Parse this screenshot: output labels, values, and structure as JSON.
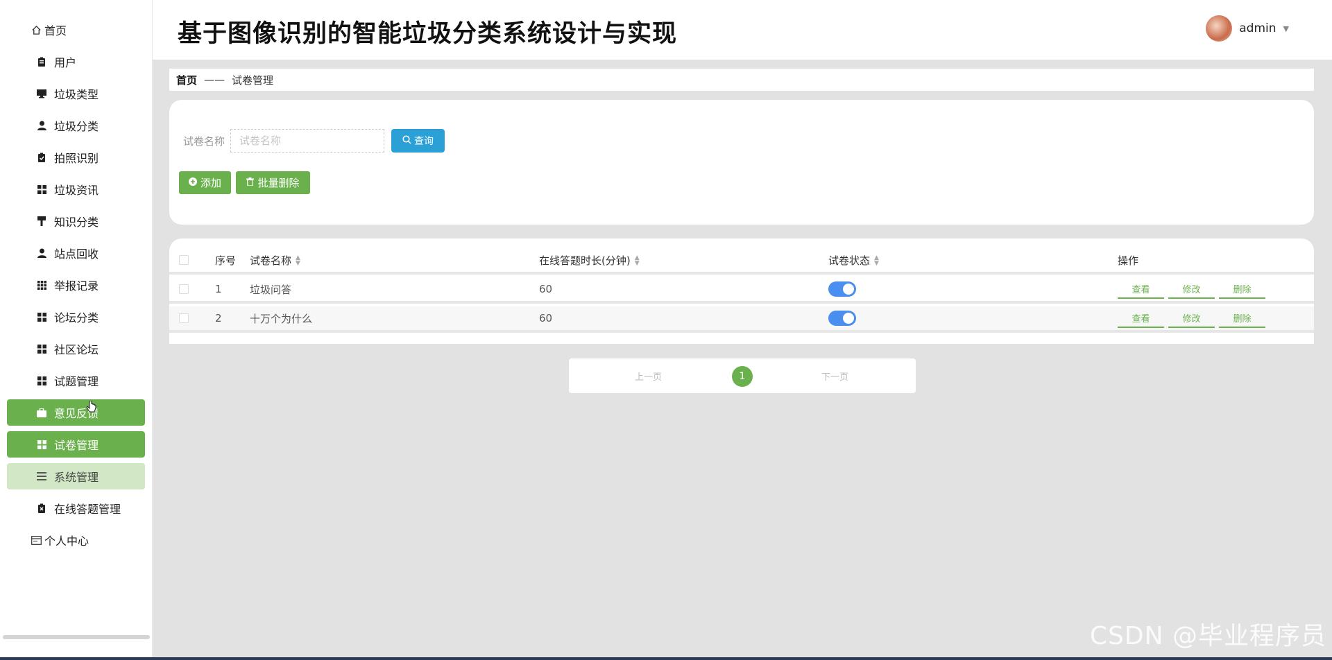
{
  "app": {
    "title": "基于图像识别的智能垃圾分类系统设计与实现"
  },
  "user": {
    "name": "admin"
  },
  "sidebar": {
    "items": [
      {
        "label": "首页",
        "icon": "home-icon"
      },
      {
        "label": "用户",
        "icon": "clipboard-icon"
      },
      {
        "label": "垃圾类型",
        "icon": "monitor-icon"
      },
      {
        "label": "垃圾分类",
        "icon": "user-icon"
      },
      {
        "label": "拍照识别",
        "icon": "clipboard-check-icon"
      },
      {
        "label": "垃圾资讯",
        "icon": "grid-icon"
      },
      {
        "label": "知识分类",
        "icon": "brush-icon"
      },
      {
        "label": "站点回收",
        "icon": "user-icon"
      },
      {
        "label": "举报记录",
        "icon": "apps-icon"
      },
      {
        "label": "论坛分类",
        "icon": "grid-icon"
      },
      {
        "label": "社区论坛",
        "icon": "grid-icon"
      },
      {
        "label": "试题管理",
        "icon": "grid-icon"
      },
      {
        "label": "意见反馈",
        "icon": "briefcase-icon"
      },
      {
        "label": "试卷管理",
        "icon": "grid-icon"
      },
      {
        "label": "系统管理",
        "icon": "list-icon"
      },
      {
        "label": "在线答题管理",
        "icon": "clipboard-x-icon"
      },
      {
        "label": "个人中心",
        "icon": "window-icon"
      }
    ],
    "active_item": "试卷管理",
    "accent_color": "#6ab04c"
  },
  "breadcrumb": {
    "home": "首页",
    "separator": "——",
    "current": "试卷管理"
  },
  "search": {
    "label": "试卷名称",
    "placeholder": "试卷名称",
    "query_button": "查询",
    "query_color": "#2aa0d6"
  },
  "actions": {
    "add": "添加",
    "batch_delete": "批量删除"
  },
  "table": {
    "headers": {
      "index": "序号",
      "name": "试卷名称",
      "duration": "在线答题时长(分钟)",
      "status": "试卷状态",
      "operations": "操作"
    },
    "rows": [
      {
        "index": "1",
        "name": "垃圾问答",
        "duration": "60",
        "status_on": true
      },
      {
        "index": "2",
        "name": "十万个为什么",
        "duration": "60",
        "status_on": true
      }
    ],
    "row_actions": {
      "view": "查看",
      "edit": "修改",
      "delete": "删除"
    }
  },
  "pagination": {
    "prev": "上一页",
    "current": "1",
    "next": "下一页"
  },
  "watermark": "CSDN @毕业程序员"
}
